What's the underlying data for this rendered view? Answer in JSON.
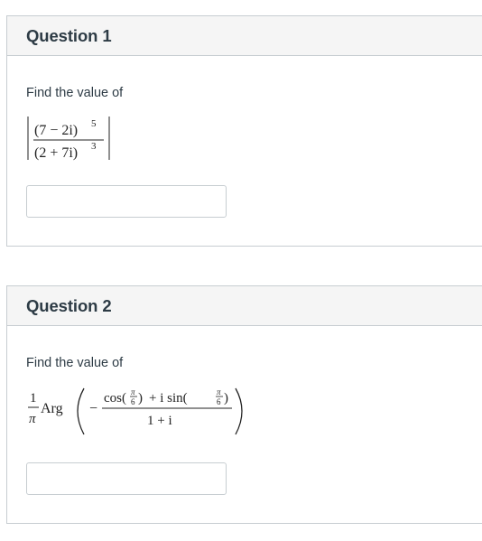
{
  "questions": [
    {
      "title": "Question 1",
      "prompt": "Find the value of",
      "math": {
        "numerator": "(7 − 2i)",
        "numerator_power": "5",
        "denominator": "(2 + 7i)",
        "denominator_power": "3"
      },
      "answer_value": ""
    },
    {
      "title": "Question 2",
      "prompt": "Find the value of",
      "math": {
        "coef_num": "1",
        "coef_den": "π",
        "func": "Arg",
        "minus": "−",
        "cos": "cos(",
        "pi": "π",
        "six": "6",
        "close": ")",
        "plus_i_sin": "+ i sin(",
        "denominator": "1 + i"
      },
      "answer_value": ""
    }
  ]
}
